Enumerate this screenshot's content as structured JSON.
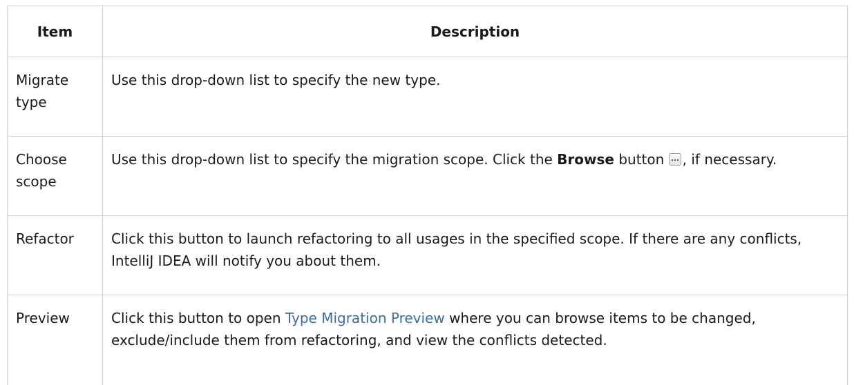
{
  "table": {
    "headers": [
      "Item",
      "Description"
    ],
    "rows": [
      {
        "item": "Migrate type",
        "description": "Use this drop-down list to specify the new type."
      },
      {
        "item": "Choose scope",
        "description_part1": "Use this drop-down list to specify the migration scope. Click the ",
        "description_bold": "Browse",
        "description_part2": " button ",
        "browse_icon": "ellipsis-button-icon",
        "description_part3": ", if necessary."
      },
      {
        "item": "Refactor",
        "description": "Click this button to launch refactoring to all usages in the specified scope. If there are any conflicts, IntelliJ IDEA will notify you about them."
      },
      {
        "item": "Preview",
        "description_part1": "Click this button to open ",
        "description_link": "Type Migration Preview",
        "description_part2": " where you can browse items to be changed, exclude/include them from refactoring, and view the conflicts detected."
      }
    ]
  },
  "colors": {
    "link": "#3a6ea5",
    "border": "#d4d4d4",
    "text": "#1a1a1a"
  }
}
